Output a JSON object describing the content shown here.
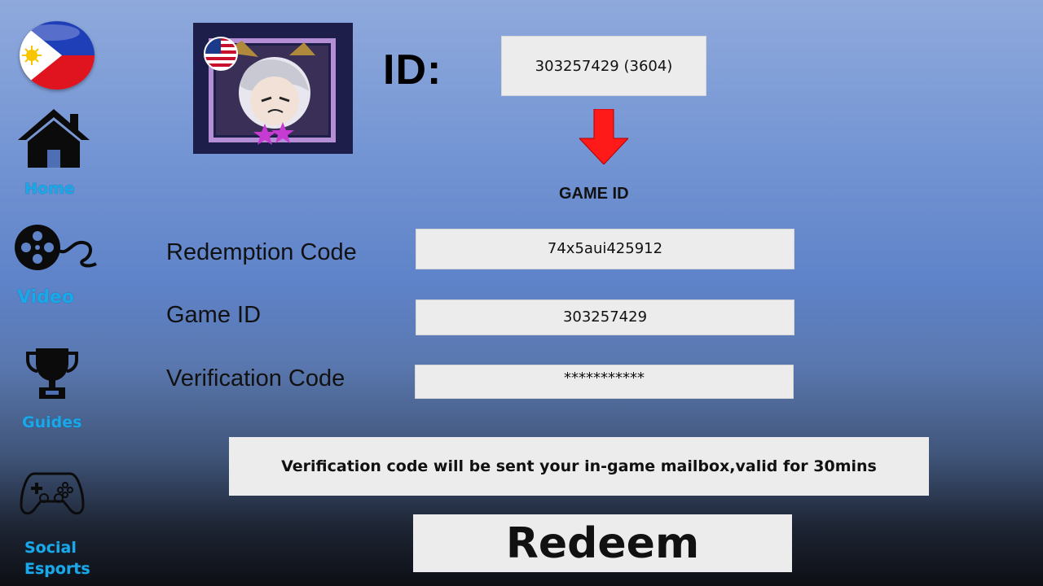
{
  "sidebar": {
    "items": [
      {
        "label": "Home",
        "icon": "home-icon"
      },
      {
        "label": "Video",
        "icon": "film-reel-icon"
      },
      {
        "label": "Guides",
        "icon": "trophy-icon"
      },
      {
        "label_line1": "Social",
        "label_line2": "Esports",
        "icon": "gamepad-icon"
      }
    ],
    "flag_icon": "philippines-flag-icon"
  },
  "profile": {
    "avatar_icon": "hero-avatar-icon",
    "region_flag": "usa-flag-icon",
    "id_title": "ID:",
    "id_value": "303257429  (3604)"
  },
  "hint": {
    "arrow_icon": "red-down-arrow-icon",
    "caption": "GAME ID"
  },
  "form": {
    "redemption_code": {
      "label": "Redemption  Code",
      "value": "74x5aui425912"
    },
    "game_id": {
      "label": "Game ID",
      "value": "303257429"
    },
    "verification_code": {
      "label": "Verification  Code",
      "value": "***********"
    }
  },
  "notice": "Verification code will be sent your in-game mailbox,valid for 30mins",
  "redeem_label": "Redeem",
  "colors": {
    "nav_text": "#1aa8e8",
    "field_bg": "#ececec",
    "arrow": "#ff1a1a"
  }
}
